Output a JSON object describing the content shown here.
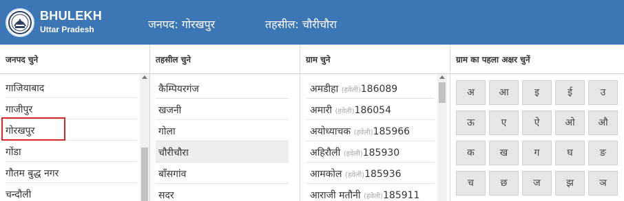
{
  "header": {
    "brand_title": "BHULEKH",
    "brand_subtitle": "Uttar Pradesh",
    "district_label": "जनपद: गोरखपुर",
    "tehsil_label": "तहसील: चौरीचौरा",
    "logo_icon": "up-government-emblem-icon"
  },
  "columns": {
    "district": {
      "heading": "जनपद चुने",
      "items": [
        "गाजियाबाद",
        "गाजीपुर",
        "गोरखपुर",
        "गोंडा",
        "गौतम बुद्ध नगर",
        "चन्दौली"
      ],
      "highlighted": "गोरखपुर",
      "highlight_color": "#d9262b"
    },
    "tehsil": {
      "heading": "तहसील चुने",
      "items": [
        "कैम्पियरगंज",
        "खजनी",
        "गोला",
        "चौरीचौरा",
        "बाँसगांव",
        "सदर"
      ],
      "selected": "चौरीचौरा"
    },
    "village": {
      "heading": "ग्राम चुने",
      "items": [
        {
          "name": "अमडीहा",
          "tag": "(हवेली)",
          "code": "186089"
        },
        {
          "name": "अमारी",
          "tag": "(हवेली)",
          "code": "186054"
        },
        {
          "name": "अयोध्याचक",
          "tag": "(हवेली)",
          "code": "185966"
        },
        {
          "name": "अहिरौली",
          "tag": "(हवेली)",
          "code": "185930"
        },
        {
          "name": "आमकोल",
          "tag": "(हवेली)",
          "code": "185936"
        },
        {
          "name": "आराजी मतौनी",
          "tag": "(हवेली)",
          "code": "185911"
        }
      ]
    },
    "letters": {
      "heading": "ग्राम का पहला अक्षर चुनें",
      "keys": [
        "अ",
        "आ",
        "इ",
        "ई",
        "उ",
        "ऊ",
        "ए",
        "ऐ",
        "ओ",
        "औ",
        "क",
        "ख",
        "ग",
        "घ",
        "ङ",
        "च",
        "छ",
        "ज",
        "झ",
        "ञ"
      ]
    }
  },
  "colors": {
    "header_bg": "#3c76b4",
    "selected_row_bg": "#eeeeee",
    "key_bg": "#e6e6e6"
  }
}
